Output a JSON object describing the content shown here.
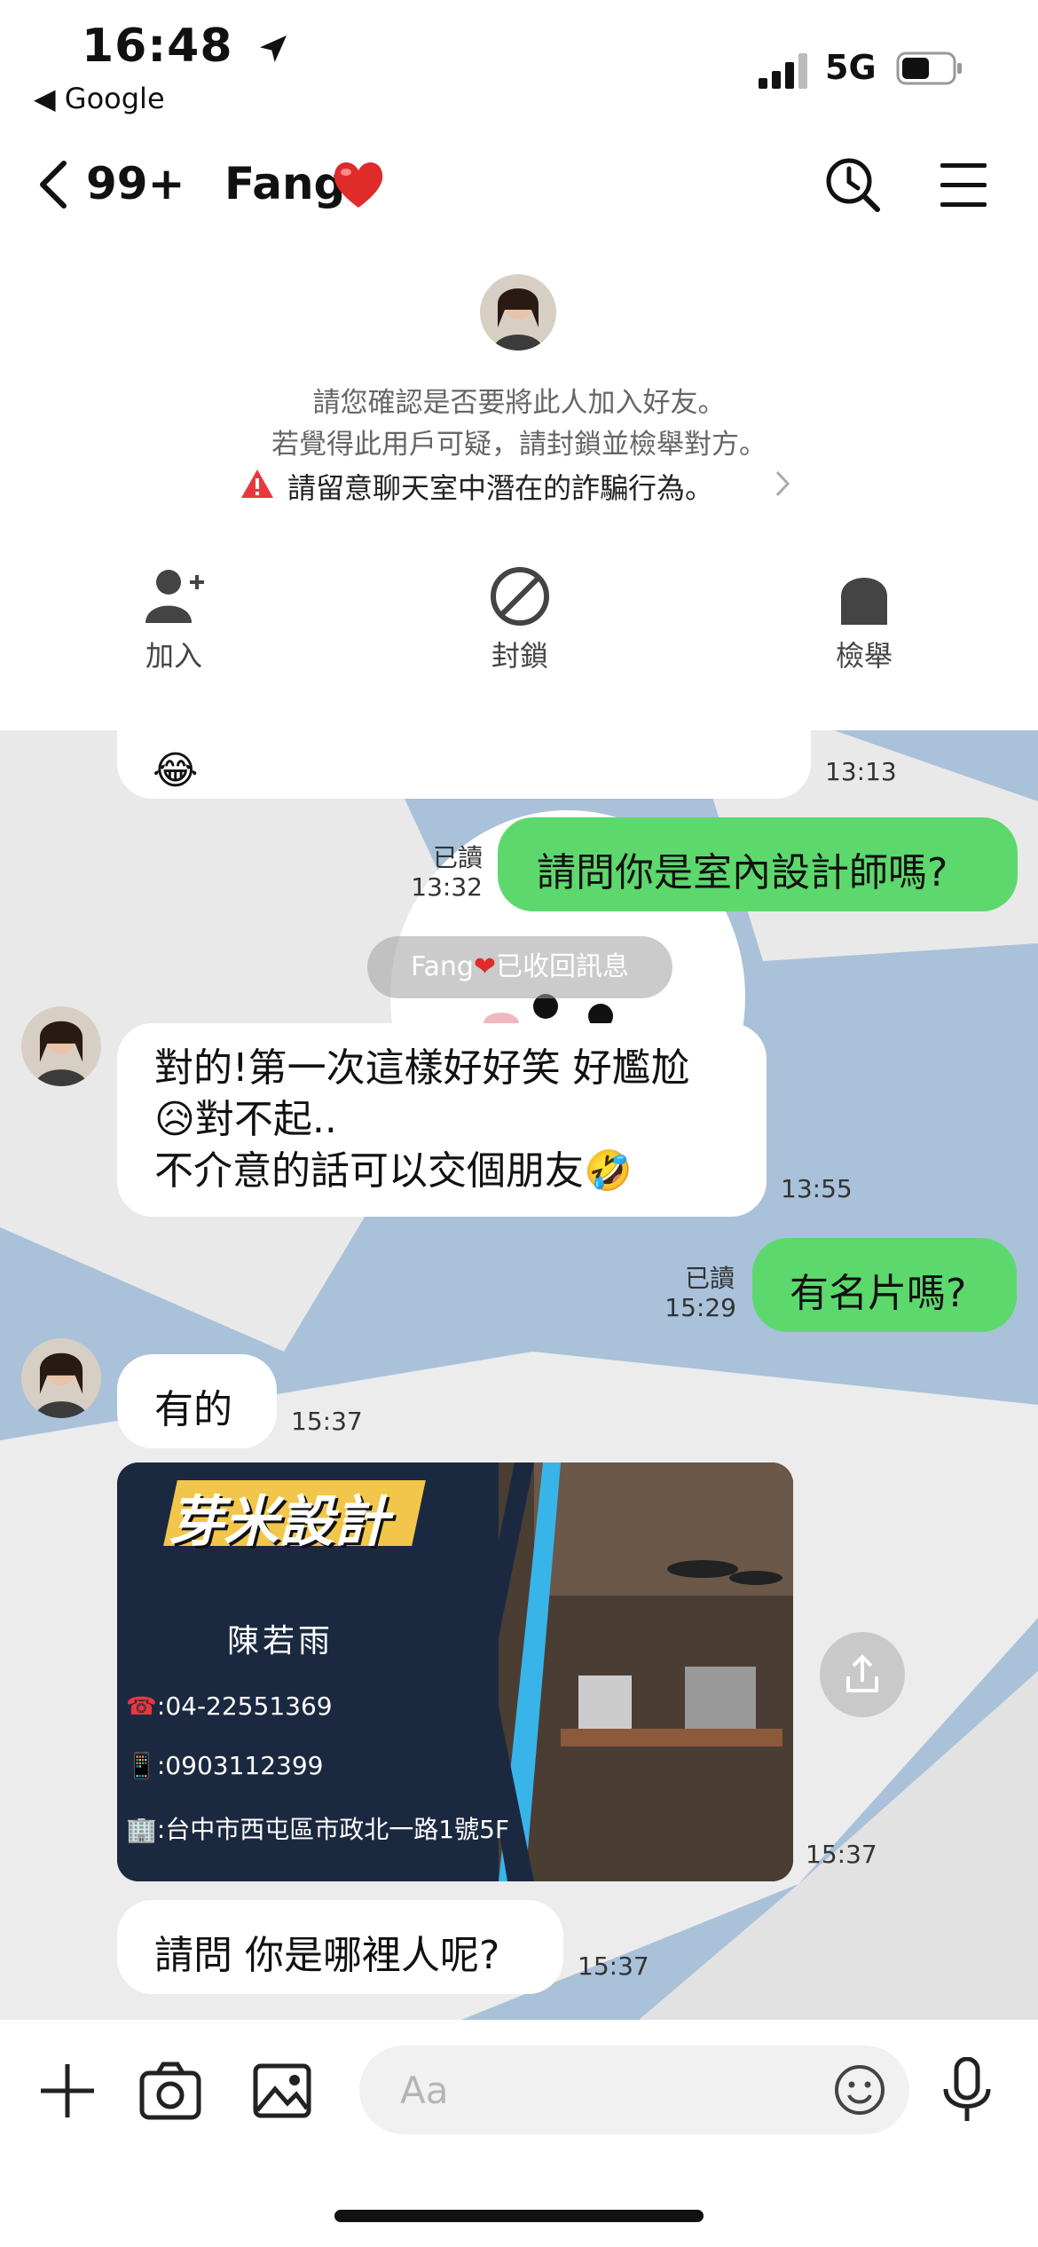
{
  "status": {
    "time": "16:48",
    "back_app": "◀ Google",
    "network": "5G"
  },
  "header": {
    "unread_count": "99+",
    "contact_name": "Fang"
  },
  "notice": {
    "line1": "請您確認是否要將此人加入好友。",
    "line2": "若覺得此用戶可疑，請封鎖並檢舉對方。",
    "warning": "請留意聊天室中潛在的詐騙行為。"
  },
  "actions": {
    "add": "加入",
    "block": "封鎖",
    "report": "檢舉"
  },
  "messages": {
    "m1_ts": "13:13",
    "m2_text": "請問你是室內設計師嗎?",
    "m2_read": "已讀",
    "m2_ts": "13:32",
    "recall_name": "Fang",
    "recall_text": "已收回訊息",
    "m3_line1": "對的!第一次這樣好好笑 好尷尬",
    "m3_line2": "對不起..",
    "m3_line3": "不介意的話可以交個朋友",
    "m3_ts": "13:55",
    "m4_text": "有名片嗎?",
    "m4_read": "已讀",
    "m4_ts": "15:29",
    "m5_text": "有的",
    "m5_ts": "15:37",
    "m6_ts": "15:37",
    "m7_text": "請問 你是哪裡人呢?",
    "m7_ts": "15:37"
  },
  "card": {
    "brand": "芽米設計",
    "person": "陳若雨",
    "phone": ":04-22551369",
    "mobile": ":0903112399",
    "address": ":台中市西屯區市政北一路1號5F"
  },
  "input": {
    "placeholder": "Aa"
  },
  "colors": {
    "outgoing": "#5dd86d",
    "chat_bg": "#a9c1d9",
    "warning": "#e8383d"
  },
  "icons": [
    "location-arrow-icon",
    "signal-icon",
    "battery-icon",
    "back-chevron-icon",
    "heart-icon",
    "search-clock-icon",
    "menu-icon",
    "warning-icon",
    "chevron-right-icon",
    "add-friend-icon",
    "block-icon",
    "report-icon",
    "share-icon",
    "plus-icon",
    "camera-icon",
    "image-icon",
    "emoji-icon",
    "mic-icon"
  ]
}
